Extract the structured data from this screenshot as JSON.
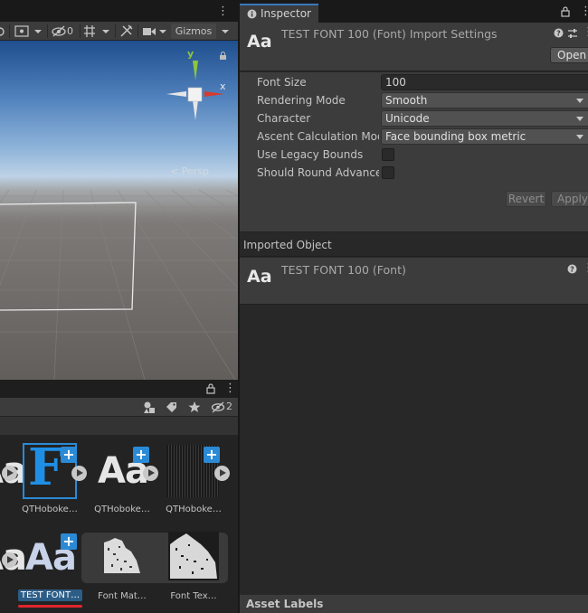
{
  "scene": {
    "toolbar": {
      "hidden_count": "0",
      "gizmos_label": "Gizmos"
    },
    "persp_label": "Persp",
    "axis_labels": {
      "y": "y",
      "x": "x"
    }
  },
  "project": {
    "hidden_count": "2",
    "assets": [
      {
        "label": "QTHoboke…",
        "kind": "font-asset-blue-F"
      },
      {
        "label": "QTHoboke…",
        "kind": "font-aa"
      },
      {
        "label": "QTHoboke…",
        "kind": "glyph-atlas"
      },
      {
        "label": "TEST FONT…",
        "kind": "font-aa-selected"
      },
      {
        "label": "Font Mat…",
        "kind": "material"
      },
      {
        "label": "Font Tex…",
        "kind": "texture"
      }
    ],
    "selected_color": "#2c5d87",
    "underline_color": "#e0262f"
  },
  "inspector": {
    "tab_label": "Inspector",
    "header": {
      "icon_text": "Aa",
      "title": "TEST FONT 100 (Font) Import Settings",
      "open_label": "Open"
    },
    "properties": {
      "font_size": {
        "label": "Font Size",
        "value": "100"
      },
      "rendering_mode": {
        "label": "Rendering Mode",
        "value": "Smooth"
      },
      "character": {
        "label": "Character",
        "value": "Unicode"
      },
      "ascent": {
        "label": "Ascent Calculation Mode",
        "value": "Face bounding box metric"
      },
      "legacy_bounds": {
        "label": "Use Legacy Bounds",
        "checked": false
      },
      "round_advance": {
        "label": "Should Round Advance Value",
        "checked": false
      }
    },
    "buttons": {
      "revert": "Revert",
      "apply": "Apply"
    },
    "imported_object_label": "Imported Object",
    "imported": {
      "icon_text": "Aa",
      "title": "TEST FONT 100 (Font)"
    },
    "asset_labels": "Asset Labels",
    "accent_color": "#3a79bb"
  }
}
